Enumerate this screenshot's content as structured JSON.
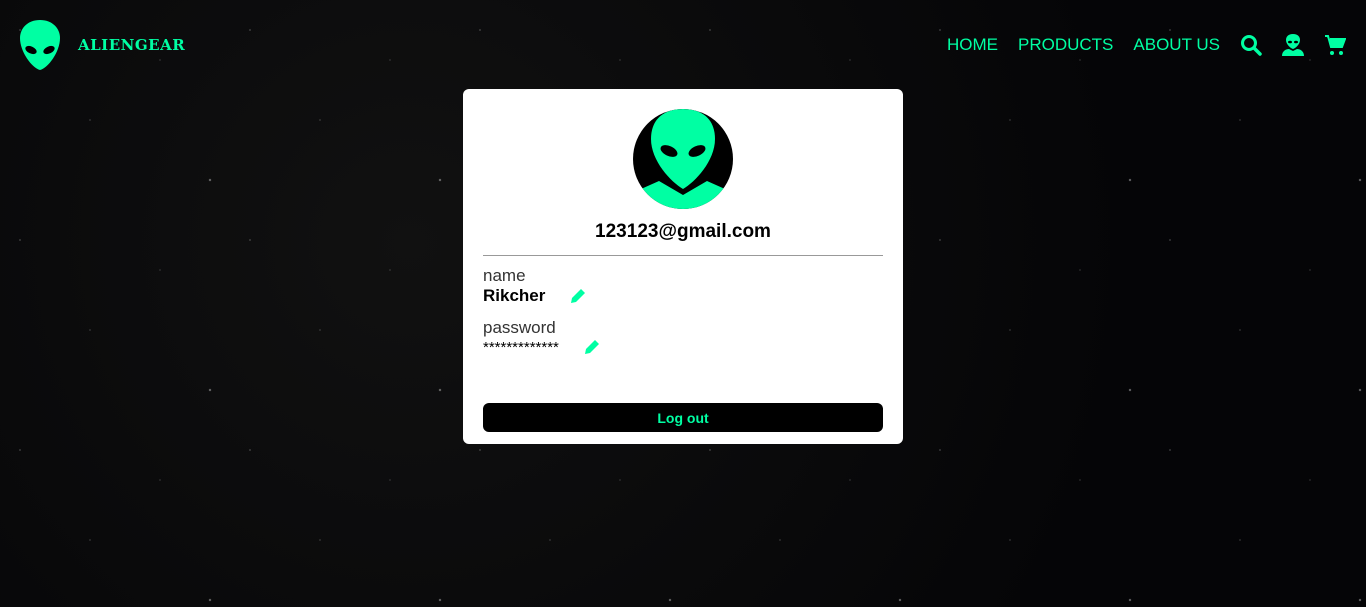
{
  "brand": {
    "name": "ALIENGEAR"
  },
  "nav": {
    "items": [
      {
        "label": "HOME"
      },
      {
        "label": "PRODUCTS"
      },
      {
        "label": "ABOUT US"
      }
    ],
    "icons": [
      "search-icon",
      "user-icon",
      "cart-icon"
    ]
  },
  "profile": {
    "email": "123123@gmail.com",
    "fields": [
      {
        "label": "name",
        "value": "Rikcher"
      },
      {
        "label": "password",
        "value": "*************"
      }
    ],
    "logout_label": "Log out"
  },
  "colors": {
    "accent": "#00ffa3"
  }
}
